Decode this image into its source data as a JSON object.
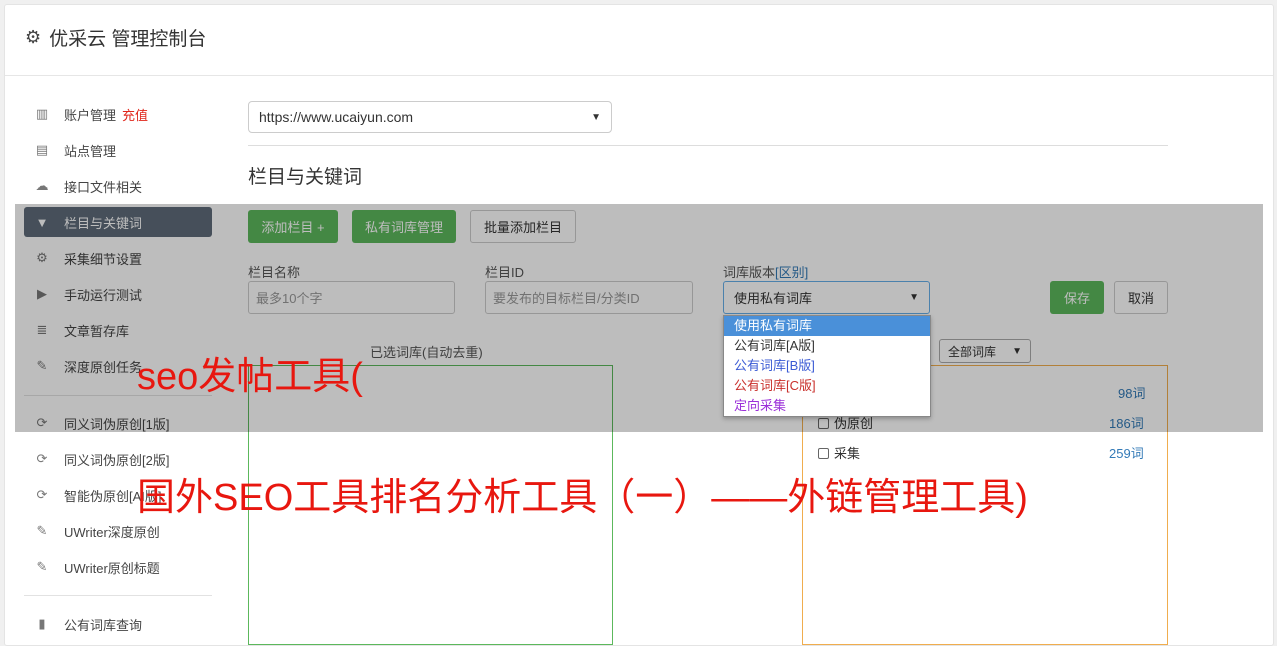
{
  "app": {
    "title": "优采云 管理控制台",
    "icon": "gear-icon"
  },
  "sidebar": {
    "recharge": "充值",
    "items": [
      {
        "label": "账户管理",
        "icon": "bar-chart-icon"
      },
      {
        "label": "站点管理",
        "icon": "server-icon"
      },
      {
        "label": "接口文件相关",
        "icon": "cloud-upload-icon"
      },
      {
        "label": "栏目与关键词",
        "icon": "filter-icon",
        "active": true
      },
      {
        "label": "采集细节设置",
        "icon": "cogs-icon"
      },
      {
        "label": "手动运行测试",
        "icon": "play-icon"
      },
      {
        "label": "文章暂存库",
        "icon": "database-icon"
      },
      {
        "label": "深度原创任务",
        "icon": "edit-icon"
      },
      {
        "label": "同义词伪原创[1版]",
        "icon": "refresh-icon"
      },
      {
        "label": "同义词伪原创[2版]",
        "icon": "refresh-icon"
      },
      {
        "label": "智能伪原创[AI版]",
        "icon": "refresh-icon"
      },
      {
        "label": "UWriter深度原创",
        "icon": "edit-icon"
      },
      {
        "label": "UWriter原创标题",
        "icon": "edit-icon"
      },
      {
        "label": "公有词库查询",
        "icon": "book-icon"
      }
    ]
  },
  "main": {
    "site_select": "https://www.ucaiyun.com",
    "section_title": "栏目与关键词",
    "buttons": {
      "add_column": "添加栏目 +",
      "private_lib": "私有词库管理",
      "batch_add": "批量添加栏目",
      "save": "保存",
      "cancel": "取消"
    },
    "form": {
      "name_label": "栏目名称",
      "name_placeholder": "最多10个字",
      "id_label": "栏目ID",
      "id_placeholder": "要发布的目标栏目/分类ID",
      "version_label": "词库版本",
      "version_link": "[区别]",
      "version_value": "使用私有词库"
    },
    "dropdown_options": [
      {
        "label": "使用私有词库",
        "color": "#ffffff",
        "selected": true
      },
      {
        "label": "公有词库[A版]",
        "color": "#333333"
      },
      {
        "label": "公有词库[B版]",
        "color": "#3b5bd4"
      },
      {
        "label": "公有词库[C版]",
        "color": "#c9302c"
      },
      {
        "label": "定向采集",
        "color": "#9b30d9"
      }
    ],
    "selected_lib_label": "已选词库(自动去重)",
    "filter_select": "全部词库",
    "lib_rows": [
      {
        "label": "",
        "count": "98词"
      },
      {
        "label": "伪原创",
        "count": "186词"
      },
      {
        "label": "采集",
        "count": "259词"
      }
    ]
  },
  "overlay_text": {
    "line1": "seo发帖工具(",
    "line2": "国外SEO工具排名分析工具（一）——外链管理工具)"
  }
}
